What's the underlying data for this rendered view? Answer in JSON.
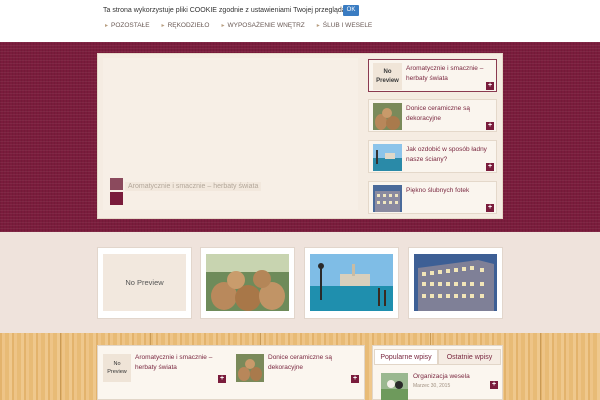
{
  "cookie_bar": {
    "message": "Ta strona wykorzystuje pliki COOKIE zgodnie z ustawieniami Twojej przeglądarki.",
    "ok_label": "OK"
  },
  "nav": {
    "items": [
      {
        "label": "POZOSTAŁE"
      },
      {
        "label": "RĘKODZIEŁO"
      },
      {
        "label": "WYPOSAŻENIE WNĘTRZ"
      },
      {
        "label": "ŚLUB I WESELE"
      }
    ]
  },
  "slider": {
    "caption": "Aromatycznie i smacznie – herbaty świata",
    "side_items": [
      {
        "title": "Aromatycznie i smacznie – herbaty świata",
        "thumb": "No Preview",
        "active": true
      },
      {
        "title": "Donice ceramiczne są dekoracyjne",
        "thumb": "pots-image"
      },
      {
        "title": "Jak ozdobić w sposób ładny nasze ściany?",
        "thumb": "harbor-image"
      },
      {
        "title": "Piękno ślubnych fotek",
        "thumb": "building-image"
      }
    ]
  },
  "thumbs": [
    {
      "label": "No Preview"
    },
    {
      "label": "pots-image"
    },
    {
      "label": "harbor-image"
    },
    {
      "label": "building-image"
    }
  ],
  "posts": [
    {
      "title": "Aromatycznie i smacznie – herbaty świata",
      "thumb": "No Preview"
    },
    {
      "title": "Donice ceramiczne są dekoracyjne",
      "thumb": "pots-image"
    }
  ],
  "widget": {
    "tabs": [
      {
        "label": "Popularne wpisy"
      },
      {
        "label": "Ostatnie wpisy"
      }
    ],
    "item": {
      "title": "Organizacja wesela",
      "date": "Marzec 30, 2015"
    }
  },
  "colors": {
    "maroon": "#7a1c3c",
    "accent": "#3a7cc2",
    "wood": "#e8bd7a"
  }
}
